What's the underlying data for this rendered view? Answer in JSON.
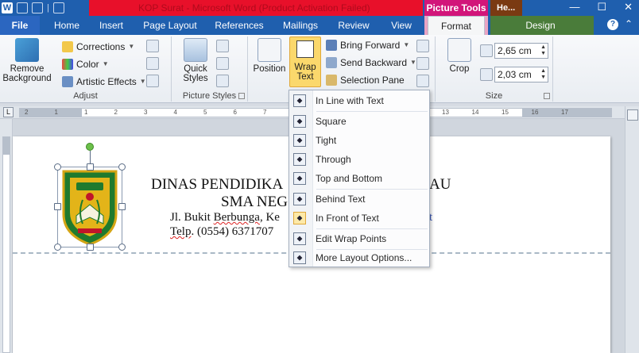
{
  "titlebar": {
    "doc_title": "KOP Surat - Microsoft Word (Product Activation Failed)",
    "picture_tools": "Picture Tools",
    "header_tools": "He...",
    "minimize": "—",
    "maximize": "☐",
    "close": "✕"
  },
  "tabs": {
    "file": "File",
    "home": "Home",
    "insert": "Insert",
    "page_layout": "Page Layout",
    "references": "References",
    "mailings": "Mailings",
    "review": "Review",
    "view": "View",
    "format": "Format",
    "design": "Design",
    "help": "?"
  },
  "ribbon": {
    "remove_background": "Remove Background",
    "corrections": "Corrections",
    "color": "Color",
    "artistic_effects": "Artistic Effects",
    "adjust_label": "Adjust",
    "quick_styles": "Quick Styles",
    "picture_styles_label": "Picture Styles",
    "position": "Position",
    "wrap_text": "Wrap Text",
    "bring_forward": "Bring Forward",
    "send_backward": "Send Backward",
    "selection_pane": "Selection Pane",
    "crop": "Crop",
    "height_value": "2,65 cm",
    "width_value": "2,03 cm",
    "size_label": "Size"
  },
  "ruler": {
    "numbers": [
      "2",
      "1",
      "1",
      "2",
      "3",
      "4",
      "5",
      "6",
      "7",
      "8",
      "9",
      "10",
      "11",
      "12",
      "13",
      "14",
      "15",
      "16",
      "17"
    ]
  },
  "document": {
    "heading1": "DINAS PENDIDIKA",
    "heading1_right": "AU",
    "heading2": "SMA NEG",
    "addr1_pre": "Jl. Bukit ",
    "addr1_sq1": "Berbunga",
    "addr1_mid": ", Ke",
    "addr2_pre": "Telp",
    "addr2_rest": ". (0554) 6371707",
    "addr_right": "t"
  },
  "wrap_menu": {
    "items": [
      {
        "label": "In Line with Text",
        "active": false
      },
      {
        "label": "Square",
        "active": false
      },
      {
        "label": "Tight",
        "active": false
      },
      {
        "label": "Through",
        "active": false
      },
      {
        "label": "Top and Bottom",
        "active": false
      },
      {
        "label": "Behind Text",
        "active": false
      },
      {
        "label": "In Front of Text",
        "active": true
      },
      {
        "label": "Edit Wrap Points",
        "active": false
      },
      {
        "label": "More Layout Options...",
        "active": false
      }
    ]
  },
  "colors": {
    "title_blue": "#1f5fae",
    "activation_red": "#e8102a",
    "picture_tools_pink": "#d2157a",
    "header_tools_brown": "#7a3a12",
    "design_green": "#4a7c3a",
    "wrap_highlight": "#fbd86c"
  }
}
